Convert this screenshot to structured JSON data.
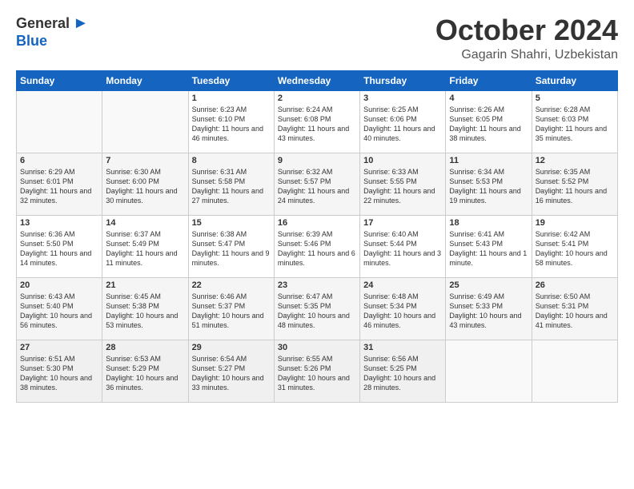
{
  "header": {
    "logo_general": "General",
    "logo_blue": "Blue",
    "month_title": "October 2024",
    "location": "Gagarin Shahri, Uzbekistan"
  },
  "weekdays": [
    "Sunday",
    "Monday",
    "Tuesday",
    "Wednesday",
    "Thursday",
    "Friday",
    "Saturday"
  ],
  "rows": [
    [
      {
        "day": "",
        "empty": true
      },
      {
        "day": "",
        "empty": true
      },
      {
        "day": "1",
        "sunrise": "6:23 AM",
        "sunset": "6:10 PM",
        "daylight": "11 hours and 46 minutes."
      },
      {
        "day": "2",
        "sunrise": "6:24 AM",
        "sunset": "6:08 PM",
        "daylight": "11 hours and 43 minutes."
      },
      {
        "day": "3",
        "sunrise": "6:25 AM",
        "sunset": "6:06 PM",
        "daylight": "11 hours and 40 minutes."
      },
      {
        "day": "4",
        "sunrise": "6:26 AM",
        "sunset": "6:05 PM",
        "daylight": "11 hours and 38 minutes."
      },
      {
        "day": "5",
        "sunrise": "6:28 AM",
        "sunset": "6:03 PM",
        "daylight": "11 hours and 35 minutes."
      }
    ],
    [
      {
        "day": "6",
        "sunrise": "6:29 AM",
        "sunset": "6:01 PM",
        "daylight": "11 hours and 32 minutes."
      },
      {
        "day": "7",
        "sunrise": "6:30 AM",
        "sunset": "6:00 PM",
        "daylight": "11 hours and 30 minutes."
      },
      {
        "day": "8",
        "sunrise": "6:31 AM",
        "sunset": "5:58 PM",
        "daylight": "11 hours and 27 minutes."
      },
      {
        "day": "9",
        "sunrise": "6:32 AM",
        "sunset": "5:57 PM",
        "daylight": "11 hours and 24 minutes."
      },
      {
        "day": "10",
        "sunrise": "6:33 AM",
        "sunset": "5:55 PM",
        "daylight": "11 hours and 22 minutes."
      },
      {
        "day": "11",
        "sunrise": "6:34 AM",
        "sunset": "5:53 PM",
        "daylight": "11 hours and 19 minutes."
      },
      {
        "day": "12",
        "sunrise": "6:35 AM",
        "sunset": "5:52 PM",
        "daylight": "11 hours and 16 minutes."
      }
    ],
    [
      {
        "day": "13",
        "sunrise": "6:36 AM",
        "sunset": "5:50 PM",
        "daylight": "11 hours and 14 minutes."
      },
      {
        "day": "14",
        "sunrise": "6:37 AM",
        "sunset": "5:49 PM",
        "daylight": "11 hours and 11 minutes."
      },
      {
        "day": "15",
        "sunrise": "6:38 AM",
        "sunset": "5:47 PM",
        "daylight": "11 hours and 9 minutes."
      },
      {
        "day": "16",
        "sunrise": "6:39 AM",
        "sunset": "5:46 PM",
        "daylight": "11 hours and 6 minutes."
      },
      {
        "day": "17",
        "sunrise": "6:40 AM",
        "sunset": "5:44 PM",
        "daylight": "11 hours and 3 minutes."
      },
      {
        "day": "18",
        "sunrise": "6:41 AM",
        "sunset": "5:43 PM",
        "daylight": "11 hours and 1 minute."
      },
      {
        "day": "19",
        "sunrise": "6:42 AM",
        "sunset": "5:41 PM",
        "daylight": "10 hours and 58 minutes."
      }
    ],
    [
      {
        "day": "20",
        "sunrise": "6:43 AM",
        "sunset": "5:40 PM",
        "daylight": "10 hours and 56 minutes."
      },
      {
        "day": "21",
        "sunrise": "6:45 AM",
        "sunset": "5:38 PM",
        "daylight": "10 hours and 53 minutes."
      },
      {
        "day": "22",
        "sunrise": "6:46 AM",
        "sunset": "5:37 PM",
        "daylight": "10 hours and 51 minutes."
      },
      {
        "day": "23",
        "sunrise": "6:47 AM",
        "sunset": "5:35 PM",
        "daylight": "10 hours and 48 minutes."
      },
      {
        "day": "24",
        "sunrise": "6:48 AM",
        "sunset": "5:34 PM",
        "daylight": "10 hours and 46 minutes."
      },
      {
        "day": "25",
        "sunrise": "6:49 AM",
        "sunset": "5:33 PM",
        "daylight": "10 hours and 43 minutes."
      },
      {
        "day": "26",
        "sunrise": "6:50 AM",
        "sunset": "5:31 PM",
        "daylight": "10 hours and 41 minutes."
      }
    ],
    [
      {
        "day": "27",
        "sunrise": "6:51 AM",
        "sunset": "5:30 PM",
        "daylight": "10 hours and 38 minutes."
      },
      {
        "day": "28",
        "sunrise": "6:53 AM",
        "sunset": "5:29 PM",
        "daylight": "10 hours and 36 minutes."
      },
      {
        "day": "29",
        "sunrise": "6:54 AM",
        "sunset": "5:27 PM",
        "daylight": "10 hours and 33 minutes."
      },
      {
        "day": "30",
        "sunrise": "6:55 AM",
        "sunset": "5:26 PM",
        "daylight": "10 hours and 31 minutes."
      },
      {
        "day": "31",
        "sunrise": "6:56 AM",
        "sunset": "5:25 PM",
        "daylight": "10 hours and 28 minutes."
      },
      {
        "day": "",
        "empty": true
      },
      {
        "day": "",
        "empty": true
      }
    ]
  ]
}
